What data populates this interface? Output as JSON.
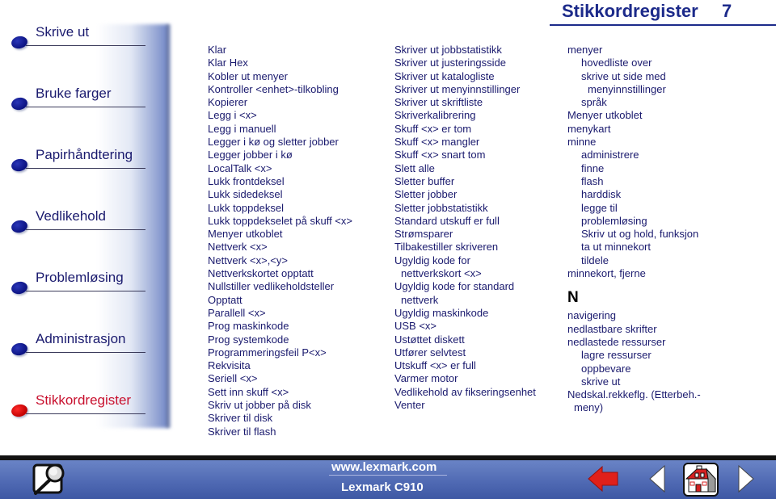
{
  "header": {
    "title": "Stikkordregister",
    "page_number": "7"
  },
  "nav": {
    "items": [
      {
        "label": "Skrive ut",
        "active": false
      },
      {
        "label": "Bruke farger",
        "active": false
      },
      {
        "label": "Papirhåndtering",
        "active": false
      },
      {
        "label": "Vedlikehold",
        "active": false
      },
      {
        "label": "Problemløsing",
        "active": false
      },
      {
        "label": "Administrasjon",
        "active": false
      },
      {
        "label": "Stikkordregister",
        "active": true
      }
    ]
  },
  "index": {
    "column1": [
      "Klar",
      "Klar Hex",
      "Kobler ut menyer",
      "Kontroller <enhet>-tilkobling",
      "Kopierer",
      "Legg i <x>",
      "Legg i manuell",
      "Legger i kø og sletter jobber",
      "Legger jobber i kø",
      "LocalTalk <x>",
      "Lukk frontdeksel",
      "Lukk sidedeksel",
      "Lukk toppdeksel",
      "Lukk toppdekselet på skuff <x>",
      "Menyer utkoblet",
      "Nettverk <x>",
      "Nettverk <x>,<y>",
      "Nettverkskortet opptatt",
      "Nullstiller vedlikeholdsteller",
      "Opptatt",
      "Parallell <x>",
      "Prog maskinkode",
      "Prog systemkode",
      "Programmeringsfeil P<x>",
      "Rekvisita",
      "Seriell <x>",
      "Sett inn skuff <x>",
      "Skriv ut jobber på disk",
      "Skriver til disk",
      "Skriver til flash"
    ],
    "column2": [
      {
        "text": "Skriver ut jobbstatistikk",
        "indent": 0
      },
      {
        "text": "Skriver ut justeringsside",
        "indent": 0
      },
      {
        "text": "Skriver ut katalogliste",
        "indent": 0
      },
      {
        "text": "Skriver ut menyinnstillinger",
        "indent": 0
      },
      {
        "text": "Skriver ut skriftliste",
        "indent": 0
      },
      {
        "text": "Skriverkalibrering",
        "indent": 0
      },
      {
        "text": "Skuff <x> er tom",
        "indent": 0
      },
      {
        "text": "Skuff <x> mangler",
        "indent": 0
      },
      {
        "text": "Skuff <x> snart tom",
        "indent": 0
      },
      {
        "text": "Slett alle",
        "indent": 0
      },
      {
        "text": "Sletter buffer",
        "indent": 0
      },
      {
        "text": "Sletter jobber",
        "indent": 0
      },
      {
        "text": "Sletter jobbstatistikk",
        "indent": 0
      },
      {
        "text": "Standard utskuff er full",
        "indent": 0
      },
      {
        "text": "Strømsparer",
        "indent": 0
      },
      {
        "text": "Tilbakestiller skriveren",
        "indent": 0
      },
      {
        "text": "Ugyldig kode for",
        "indent": 0
      },
      {
        "text": "nettverkskort <x>",
        "indent": 1
      },
      {
        "text": "Ugyldig kode for standard",
        "indent": 0
      },
      {
        "text": "nettverk",
        "indent": 1
      },
      {
        "text": "Ugyldig maskinkode",
        "indent": 0
      },
      {
        "text": "USB <x>",
        "indent": 0
      },
      {
        "text": "Ustøttet diskett",
        "indent": 0
      },
      {
        "text": "Utfører selvtest",
        "indent": 0
      },
      {
        "text": "Utskuff <x> er full",
        "indent": 0
      },
      {
        "text": "Varmer motor",
        "indent": 0
      },
      {
        "text": "Vedlikehold av fikseringsenhet",
        "indent": 0
      },
      {
        "text": "Venter",
        "indent": 0
      }
    ],
    "column3_top": [
      {
        "text": "menyer",
        "indent": 0
      },
      {
        "text": "hovedliste over",
        "indent": 2
      },
      {
        "text": "skrive ut side med",
        "indent": 2
      },
      {
        "text": "menyinnstillinger",
        "indent": 3
      },
      {
        "text": "språk",
        "indent": 2
      },
      {
        "text": "Menyer utkoblet",
        "indent": 0
      },
      {
        "text": "menykart",
        "indent": 0
      },
      {
        "text": "minne",
        "indent": 0
      },
      {
        "text": "administrere",
        "indent": 2
      },
      {
        "text": "finne",
        "indent": 2
      },
      {
        "text": "flash",
        "indent": 2
      },
      {
        "text": "harddisk",
        "indent": 2
      },
      {
        "text": "legge til",
        "indent": 2
      },
      {
        "text": "problemløsing",
        "indent": 2
      },
      {
        "text": "Skriv ut og hold, funksjon",
        "indent": 2
      },
      {
        "text": "ta ut minnekort",
        "indent": 2
      },
      {
        "text": "tildele",
        "indent": 2
      },
      {
        "text": "minnekort, fjerne",
        "indent": 0
      }
    ],
    "section_letter": "N",
    "column3_bottom": [
      {
        "text": "navigering",
        "indent": 0
      },
      {
        "text": "nedlastbare skrifter",
        "indent": 0
      },
      {
        "text": "nedlastede ressurser",
        "indent": 0
      },
      {
        "text": "lagre ressurser",
        "indent": 2
      },
      {
        "text": "oppbevare",
        "indent": 2
      },
      {
        "text": "skrive ut",
        "indent": 2
      },
      {
        "text": "Nedskal.rekkeflg. (Etterbeh.-",
        "indent": 0
      },
      {
        "text": "meny)",
        "indent": 1
      }
    ]
  },
  "footer": {
    "url": "www.lexmark.com",
    "model": "Lexmark C910",
    "icons": {
      "search": "search-icon",
      "back": "back-arrow-icon",
      "prev": "previous-page-icon",
      "home": "home-icon",
      "next": "next-page-icon"
    },
    "colors": {
      "bar": "#4e68b2",
      "back_arrow": "#e0201a"
    }
  },
  "colors": {
    "text": "#1a1a6e",
    "active_nav": "#c8102e",
    "header": "#1c2a8a"
  }
}
